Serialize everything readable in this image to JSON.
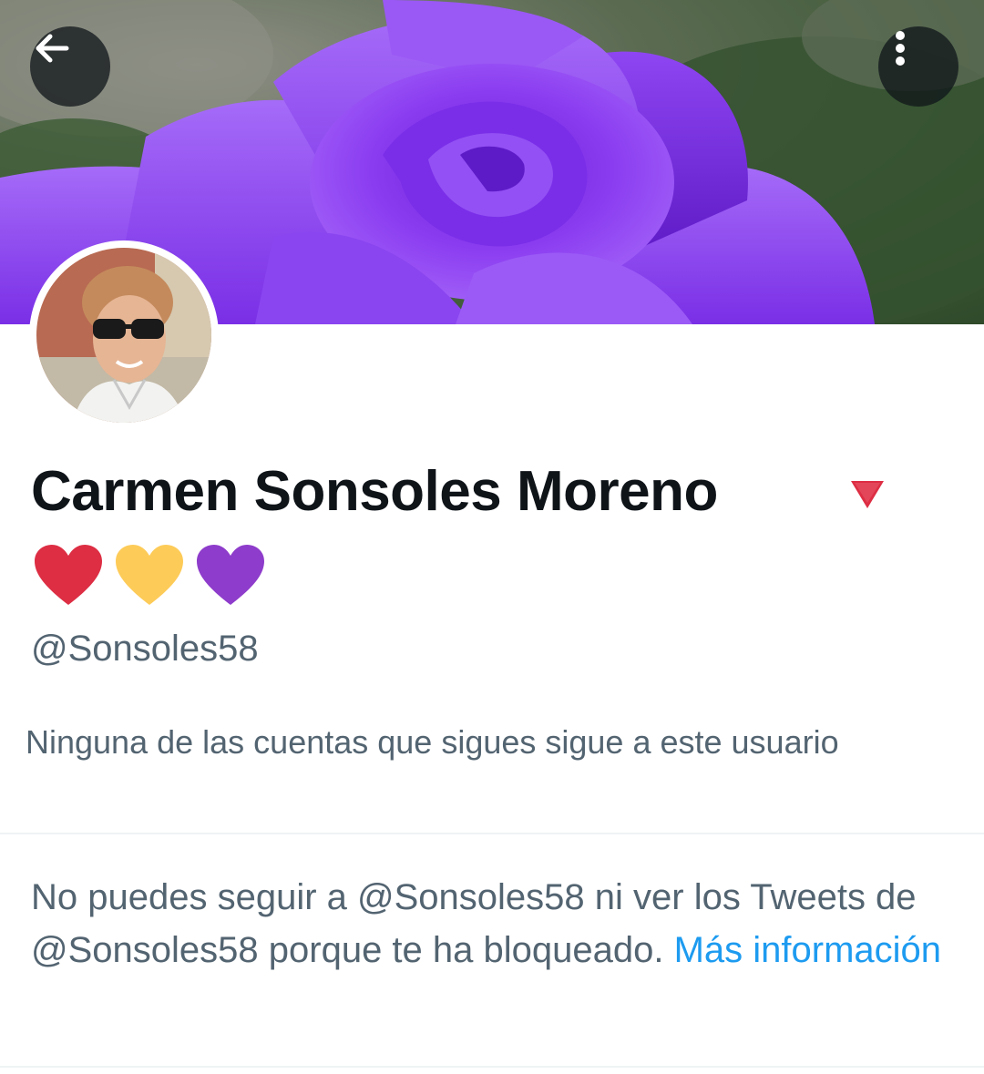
{
  "header": {
    "back_icon": "arrow-left-icon",
    "more_icon": "more-vertical-icon"
  },
  "banner": {
    "description_icon": "purple-rose-image"
  },
  "profile": {
    "name": "Carmen Sonsoles Moreno",
    "name_emoji_triangle": "red-triangle-down-icon",
    "hearts": [
      {
        "name": "red-heart-icon",
        "color": "#dd2e44"
      },
      {
        "name": "yellow-heart-icon",
        "color": "#fdcb58"
      },
      {
        "name": "purple-heart-icon",
        "color": "#8e3ccb"
      }
    ],
    "handle": "@Sonsoles58",
    "followers_note": "Ninguna de las cuentas que sigues sigue a este usuario"
  },
  "blocked": {
    "message": "No puedes seguir a @Sonsoles58 ni ver los Tweets de @Sonsoles58 porque te ha bloqueado.",
    "link_label": "Más información"
  },
  "colors": {
    "text_primary": "#0f1419",
    "text_secondary": "#536471",
    "link": "#1d9bf0",
    "divider": "#eff3f4"
  }
}
